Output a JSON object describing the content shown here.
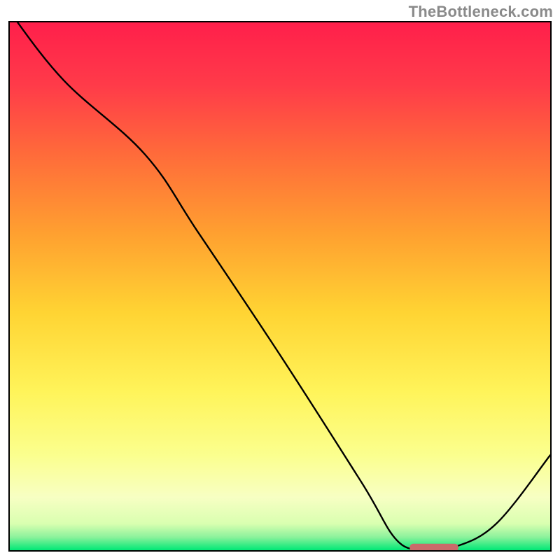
{
  "watermark": "TheBottleneck.com",
  "chart_data": {
    "type": "line",
    "title": "",
    "xlabel": "",
    "ylabel": "",
    "xlim": [
      0,
      100
    ],
    "ylim": [
      0,
      100
    ],
    "series": [
      {
        "name": "curve",
        "x": [
          0,
          10,
          25,
          35,
          50,
          65,
          72,
          78,
          82,
          90,
          100
        ],
        "values": [
          102,
          89,
          75,
          60,
          37,
          13,
          1.5,
          0.5,
          0.5,
          5,
          18
        ]
      }
    ],
    "marker": {
      "name": "minimum-marker",
      "x_start": 74,
      "x_end": 83,
      "y": 0.5,
      "color": "#c96a6a"
    },
    "gradient_stops": [
      {
        "offset": 0.0,
        "color": "#ff1f4b"
      },
      {
        "offset": 0.12,
        "color": "#ff3b49"
      },
      {
        "offset": 0.25,
        "color": "#ff6b3a"
      },
      {
        "offset": 0.4,
        "color": "#ffa030"
      },
      {
        "offset": 0.55,
        "color": "#ffd433"
      },
      {
        "offset": 0.7,
        "color": "#fff45a"
      },
      {
        "offset": 0.82,
        "color": "#fbff8e"
      },
      {
        "offset": 0.9,
        "color": "#f7ffc3"
      },
      {
        "offset": 0.95,
        "color": "#d9ffb0"
      },
      {
        "offset": 0.975,
        "color": "#8cf29c"
      },
      {
        "offset": 1.0,
        "color": "#00e876"
      }
    ]
  }
}
